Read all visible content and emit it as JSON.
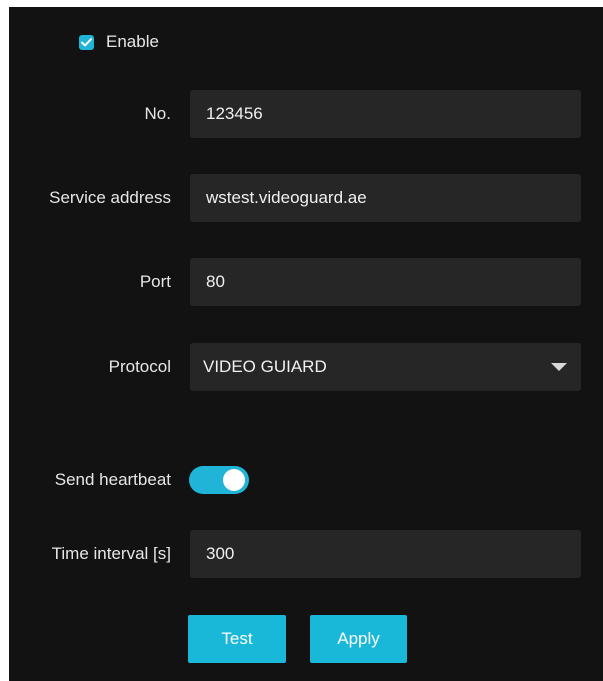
{
  "enable": {
    "label": "Enable",
    "checked": true
  },
  "fields": {
    "no": {
      "label": "No.",
      "value": "123456"
    },
    "service_address": {
      "label": "Service address",
      "value": "wstest.videoguard.ae"
    },
    "port": {
      "label": "Port",
      "value": "80"
    },
    "protocol": {
      "label": "Protocol",
      "selected": "VIDEO GUIARD"
    },
    "send_heartbeat": {
      "label": "Send heartbeat",
      "on": true
    },
    "time_interval": {
      "label": "Time interval [s]",
      "value": "300"
    }
  },
  "buttons": {
    "test_label": "Test",
    "apply_label": "Apply"
  },
  "colors": {
    "accent": "#1fb4d8",
    "panel_background": "#121212",
    "field_background": "#262626"
  }
}
